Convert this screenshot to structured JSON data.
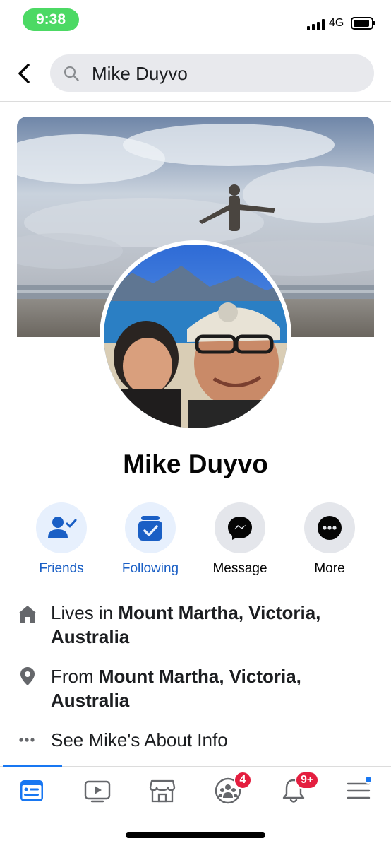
{
  "status_bar": {
    "time": "9:38",
    "network": "4G",
    "colors": {
      "time_pill": "#4cd964"
    }
  },
  "search": {
    "query": "Mike Duyvo"
  },
  "profile": {
    "name": "Mike Duyvo",
    "cover_photo_icon": "cover-photo",
    "avatar_icon": "profile-picture"
  },
  "actions": [
    {
      "label": "Friends",
      "icon": "friends-check-icon",
      "style": "primary"
    },
    {
      "label": "Following",
      "icon": "following-icon",
      "style": "primary"
    },
    {
      "label": "Message",
      "icon": "messenger-icon",
      "style": "secondary"
    },
    {
      "label": "More",
      "icon": "more-dots-icon",
      "style": "secondary"
    }
  ],
  "info": {
    "lives_prefix": "Lives in ",
    "lives_place": "Mount Martha, Victoria, Australia",
    "from_prefix": "From ",
    "from_place": "Mount Martha, Victoria, Australia",
    "about_link": "See Mike's About Info"
  },
  "tabbar": {
    "tabs": [
      {
        "name": "news-feed",
        "icon": "news-feed-icon",
        "active": true
      },
      {
        "name": "watch",
        "icon": "watch-video-icon"
      },
      {
        "name": "marketplace",
        "icon": "marketplace-icon"
      },
      {
        "name": "groups",
        "icon": "groups-icon",
        "badge": "4"
      },
      {
        "name": "notifications",
        "icon": "bell-icon",
        "badge": "9+"
      },
      {
        "name": "menu",
        "icon": "menu-icon",
        "dot": true
      }
    ],
    "colors": {
      "accent": "#1877f2",
      "badge": "#e41e3f"
    }
  }
}
